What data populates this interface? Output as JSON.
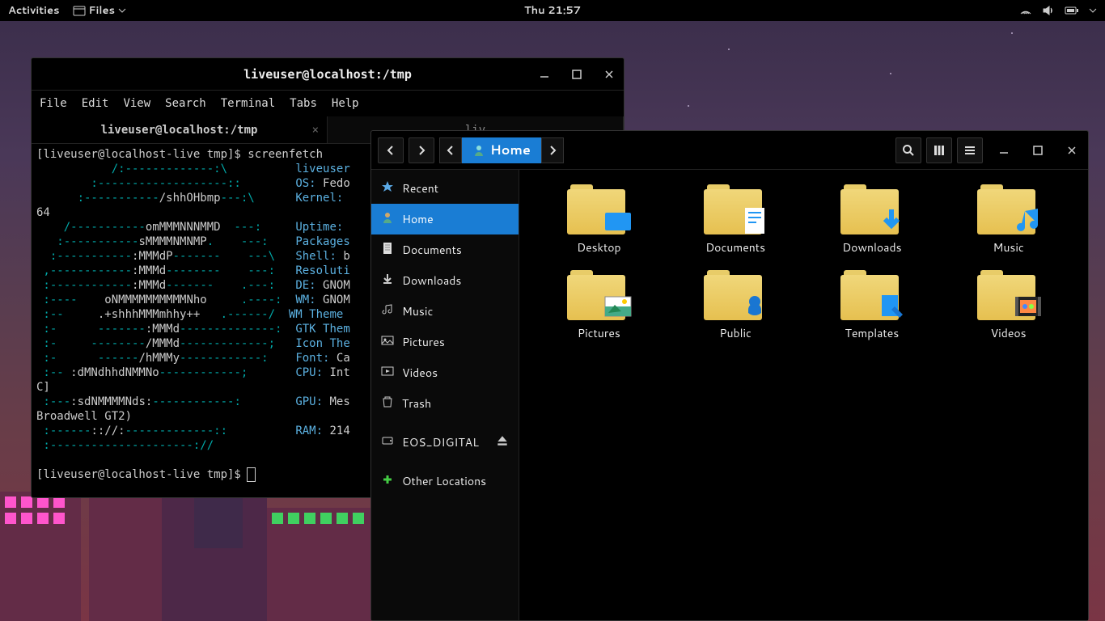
{
  "topbar": {
    "activities": "Activities",
    "app_name": "Files",
    "clock": "Thu 21:57"
  },
  "terminal": {
    "title": "liveuser@localhost:/tmp",
    "menus": [
      "File",
      "Edit",
      "View",
      "Search",
      "Terminal",
      "Tabs",
      "Help"
    ],
    "tabs": [
      {
        "label": "liveuser@localhost:/tmp",
        "active": true
      },
      {
        "label": "liv",
        "active": false
      }
    ],
    "prompt1": "[liveuser@localhost-live tmp]$ ",
    "cmd": "screenfetch",
    "ascii": [
      "           /:-------------:\\          ",
      "        :-------------------::        ",
      "      :-----------/shhOHbmp---:\\      ",
      "    /-----------omMMMNNNMMD  ---:     ",
      "   :-----------sMMMMNMNMP.    ---:    ",
      "  :-----------:MMMdP-------    ---\\   ",
      " ,------------:MMMd--------    ---:   ",
      " :------------:MMMd-------    .---:   ",
      " :----    oNMMMMMMMMMMNho     .----:  ",
      " :--      .+shhhMMMmhhy++   .------/  ",
      " :-      -------:MMMd--------------:  ",
      " :-     --------/MMMd-------------;   ",
      " :-    ------/hMMMy------------:   ",
      " :-- :dMNdhhdNMMNo------------;    ",
      " :---:sdNMMMMNds:------------:     ",
      " :------:://:-------------::       ",
      " :---------------------://         "
    ],
    "info_keys": [
      "liveuser",
      "OS:",
      "Kernel:",
      "",
      "Uptime:",
      "Packages",
      "Shell:",
      "Resoluti",
      "DE:",
      "WM:",
      "WM Theme",
      "GTK Them",
      "Icon The",
      "Font:",
      "CPU:",
      "",
      "GPU:",
      "",
      "RAM:"
    ],
    "info_vals": [
      "",
      " Fedo",
      "",
      "",
      "",
      "",
      " b",
      "",
      " GNOM",
      " GNOM",
      "",
      "",
      "",
      " Ca",
      " Int",
      "",
      " Mes",
      "",
      " 214"
    ],
    "extra_lines": [
      "64",
      "C]",
      "Broadwell GT2)"
    ],
    "prompt2": "[liveuser@localhost-live tmp]$ "
  },
  "files": {
    "breadcrumb": "Home",
    "sidebar": [
      {
        "icon": "star",
        "label": "Recent"
      },
      {
        "icon": "home",
        "label": "Home",
        "active": true
      },
      {
        "icon": "doc",
        "label": "Documents"
      },
      {
        "icon": "down",
        "label": "Downloads"
      },
      {
        "icon": "music",
        "label": "Music"
      },
      {
        "icon": "pic",
        "label": "Pictures"
      },
      {
        "icon": "vid",
        "label": "Videos"
      },
      {
        "icon": "trash",
        "label": "Trash"
      },
      {
        "icon": "drive",
        "label": "EOS_DIGITAL",
        "eject": true
      },
      {
        "icon": "plus",
        "label": "Other Locations"
      }
    ],
    "folders": [
      {
        "name": "Desktop",
        "overlay": "desktop"
      },
      {
        "name": "Documents",
        "overlay": "doc"
      },
      {
        "name": "Downloads",
        "overlay": "down"
      },
      {
        "name": "Music",
        "overlay": "music"
      },
      {
        "name": "Pictures",
        "overlay": "pic"
      },
      {
        "name": "Public",
        "overlay": "public"
      },
      {
        "name": "Templates",
        "overlay": "tmpl"
      },
      {
        "name": "Videos",
        "overlay": "vid"
      }
    ]
  }
}
